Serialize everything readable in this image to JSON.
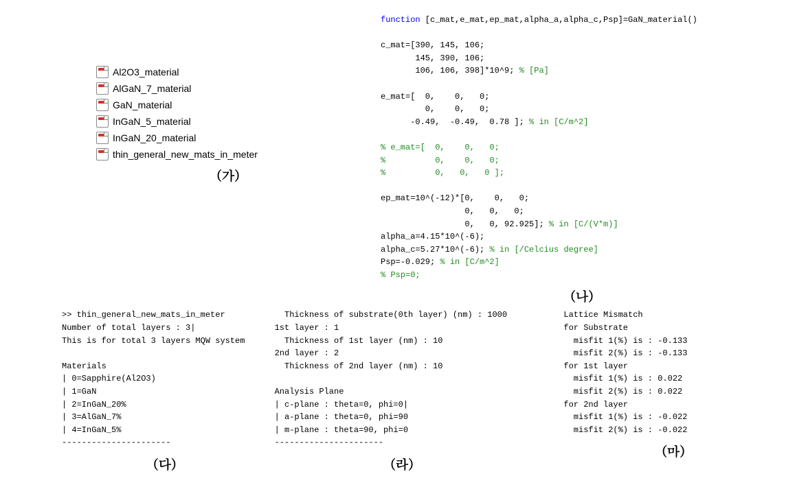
{
  "panelA": {
    "files": [
      "Al2O3_material",
      "AlGaN_7_material",
      "GaN_material",
      "InGaN_5_material",
      "InGaN_20_material",
      "thin_general_new_mats_in_meter"
    ],
    "label": "(가)"
  },
  "panelB": {
    "func_kw": "function",
    "func_sig": " [c_mat,e_mat,ep_mat,alpha_a,alpha_c,Psp]=GaN_material()",
    "cmat1": "c_mat=[390, 145, 106;",
    "cmat2": "       145, 390, 106;",
    "cmat3": "       106, 106, 398]*10^9; ",
    "cmat3_comment": "% [Pa]",
    "emat1": "e_mat=[  0,    0,   0;",
    "emat2": "         0,    0,   0;",
    "emat3": "      -0.49,  -0.49,  0.78 ]; ",
    "emat3_comment": "% in [C/m^2]",
    "emat_c1": "% e_mat=[  0,    0,   0;",
    "emat_c2": "%          0,    0,   0;",
    "emat_c3": "%          0,   0,   0 ];",
    "epmat1": "ep_mat=10^(-12)*[0,    0,   0;",
    "epmat2": "                 0,   0,   0;",
    "epmat3": "                 0,   0, 92.925]; ",
    "epmat3_comment": "% in [C/(V*m)]",
    "alpha_a": "alpha_a=4.15*10^(-6);",
    "alpha_c": "alpha_c=5.27*10^(-6); ",
    "alpha_c_comment": "% in [/Celcius degree]",
    "psp": "Psp=-0.029; ",
    "psp_comment": "% in [C/m^2]",
    "psp0": "% Psp=0;",
    "label": "(나)"
  },
  "panelC": {
    "l1": ">> thin_general_new_mats_in_meter",
    "l2": "Number of total layers : 3|",
    "l3": "This is for total 3 layers MQW system",
    "l4": "",
    "l5": "Materials",
    "l6": "| 0=Sapphire(Al2O3)",
    "l7": "| 1=GaN",
    "l8": "| 2=InGaN_20%",
    "l9": "| 3=AlGaN_7%",
    "l10": "| 4=InGaN_5%",
    "l11": "----------------------",
    "label": "(다)"
  },
  "panelD": {
    "l1": "  Thickness of substrate(0th layer) (nm) : 1000",
    "l2": "1st layer : 1",
    "l3": "  Thickness of 1st layer (nm) : 10",
    "l4": "2nd layer : 2",
    "l5": "  Thickness of 2nd layer (nm) : 10",
    "l6": "",
    "l7": "Analysis Plane",
    "l8": "| c-plane : theta=0, phi=0|",
    "l9": "| a-plane : theta=0, phi=90",
    "l10": "| m-plane : theta=90, phi=0",
    "l11": "----------------------",
    "label": "(라)"
  },
  "panelE": {
    "l1": "Lattice Mismatch",
    "l2": "for Substrate",
    "l3": "  misfit 1(%) is : -0.133",
    "l4": "  misfit 2(%) is : -0.133",
    "l5": "for 1st layer",
    "l6": "  misfit 1(%) is : 0.022",
    "l7": "  misfit 2(%) is : 0.022",
    "l8": "for 2nd layer",
    "l9": "  misfit 1(%) is : -0.022",
    "l10": "  misfit 2(%) is : -0.022",
    "label": "(마)"
  }
}
